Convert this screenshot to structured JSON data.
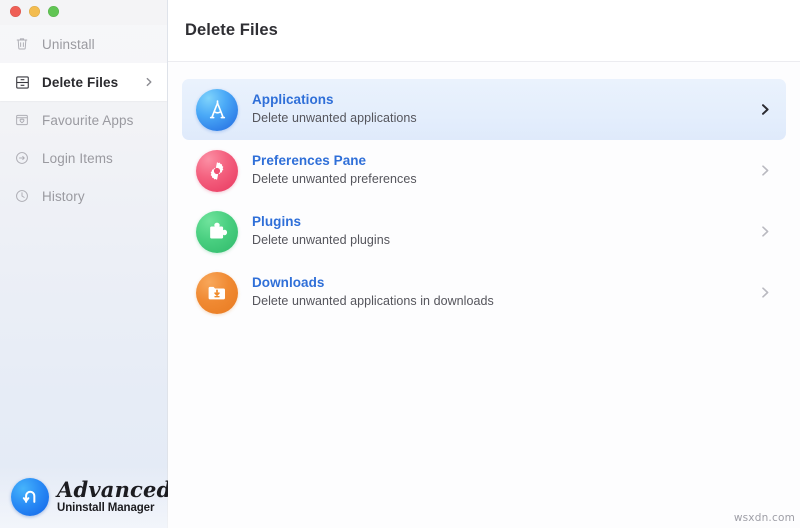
{
  "window": {
    "traffic_lights": [
      {
        "name": "close",
        "color": "#ef5f56"
      },
      {
        "name": "minimize",
        "color": "#f3bc4f"
      },
      {
        "name": "zoom",
        "color": "#61c554"
      }
    ]
  },
  "sidebar": {
    "items": [
      {
        "label": "Uninstall",
        "icon": "trash-icon",
        "selected": false
      },
      {
        "label": "Delete Files",
        "icon": "file-drawer-icon",
        "selected": true
      },
      {
        "label": "Favourite Apps",
        "icon": "heart-window-icon",
        "selected": false
      },
      {
        "label": "Login Items",
        "icon": "sign-in-arrow-icon",
        "selected": false
      },
      {
        "label": "History",
        "icon": "clock-icon",
        "selected": false
      }
    ]
  },
  "brand": {
    "title": "Advanced",
    "subtitle": "Uninstall Manager",
    "logo_icon": "u-turn-arrow-icon",
    "logo_color": "#1163e8"
  },
  "header": {
    "title": "Delete Files"
  },
  "main": {
    "rows": [
      {
        "title": "Applications",
        "subtitle": "Delete unwanted applications",
        "icon": "compass-icon",
        "icon_class": "icon-applications",
        "accent": "#2f7fe8",
        "active": true
      },
      {
        "title": "Preferences Pane",
        "subtitle": "Delete unwanted preferences",
        "icon": "gear-icon",
        "icon_class": "icon-preferences",
        "accent": "#e8375f",
        "active": false
      },
      {
        "title": "Plugins",
        "subtitle": "Delete unwanted plugins",
        "icon": "puzzle-piece-icon",
        "icon_class": "icon-plugins",
        "accent": "#2fb96a",
        "active": false
      },
      {
        "title": "Downloads",
        "subtitle": "Delete unwanted applications in downloads",
        "icon": "folder-download-icon",
        "icon_class": "icon-downloads",
        "accent": "#e87a20",
        "active": false
      }
    ]
  },
  "watermark": {
    "text": "wsxdn.com"
  }
}
